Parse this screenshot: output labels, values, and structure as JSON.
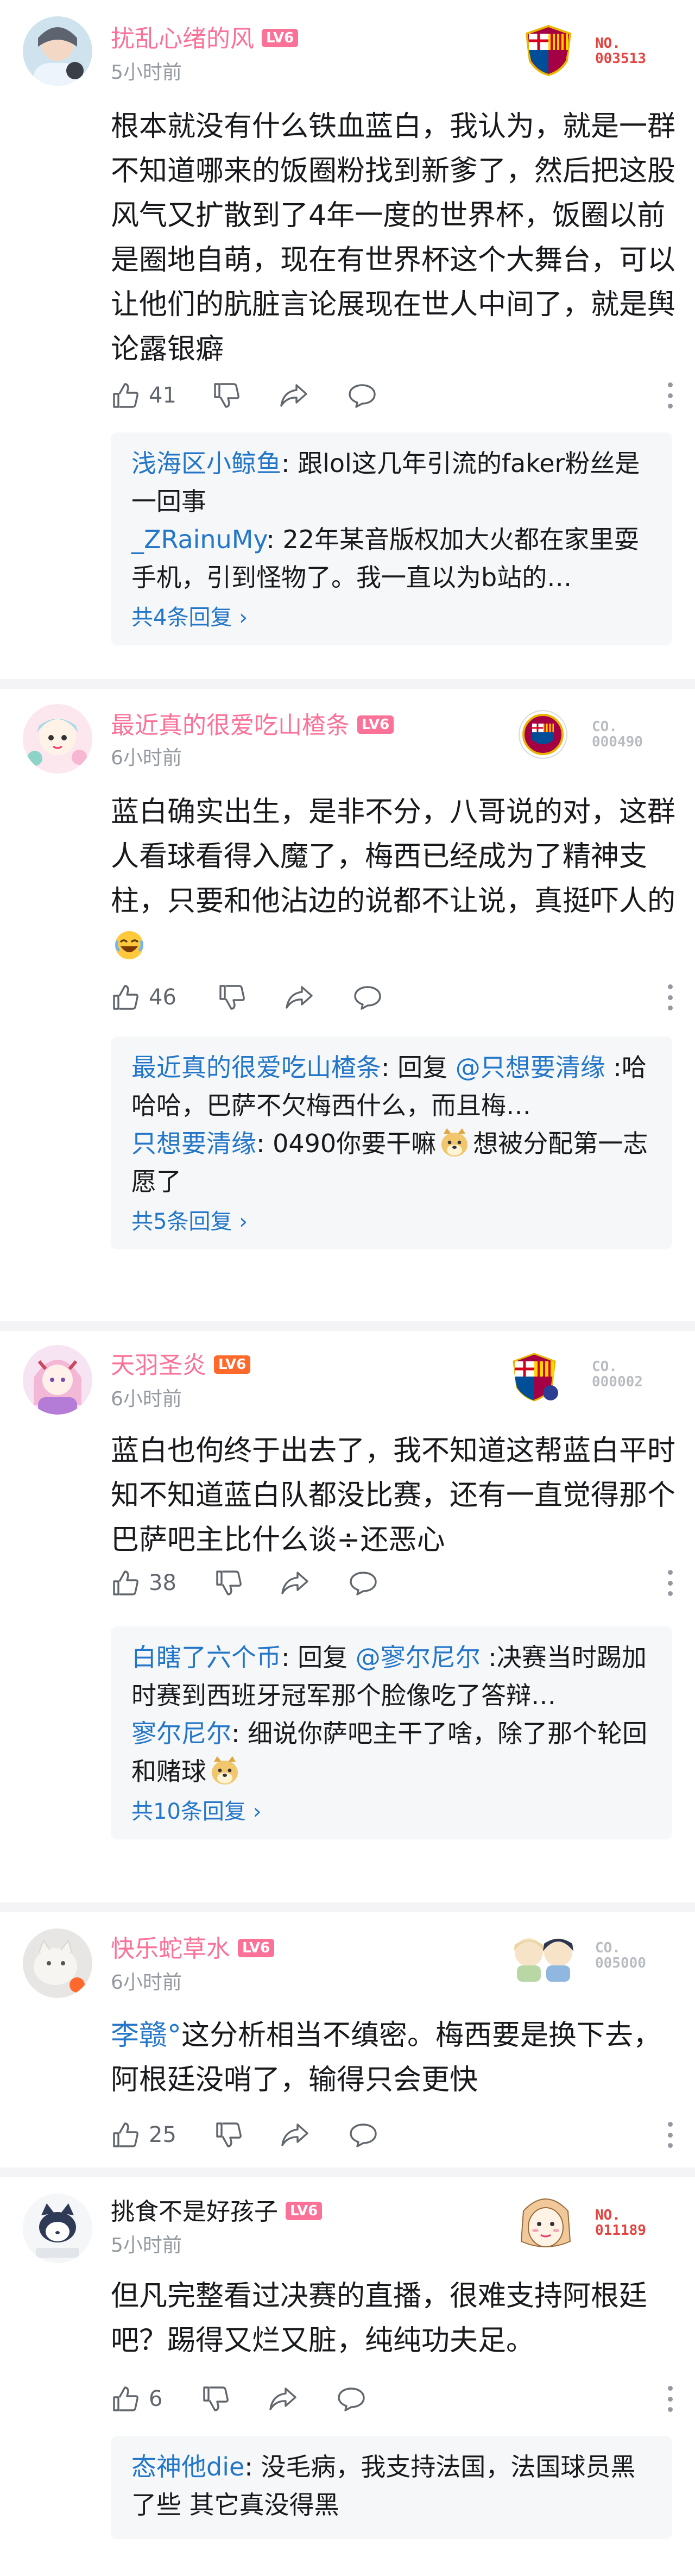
{
  "comments": [
    {
      "username": "扰乱心绪的风",
      "level": "LV6",
      "time": "5小时前",
      "fan_badge": "NO.\n003513",
      "content": "根本就没有什么铁血蓝白，我认为，就是一群不知道哪来的饭圈粉找到新爹了，然后把这股风气又扩散到了4年一度的世界杯，饭圈以前是圈地自萌，现在有世界杯这个大舞台，可以让他们的肮脏言论展现在世人中间了，就是舆论露银癖",
      "likes": "41",
      "replies": [
        {
          "name": "浅海区小鲸鱼",
          "sep": ": ",
          "text": "跟lol这几年引流的faker粉丝是一回事"
        },
        {
          "name": "_ZRainuMy",
          "sep": ": ",
          "text": "22年某音版权加大火都在家里耍手机，引到怪物了。我一直以为b站的…"
        }
      ],
      "more_replies": "共4条回复 ›"
    },
    {
      "username": "最近真的很爱吃山楂条",
      "level": "LV6",
      "time": "6小时前",
      "fan_badge": "CO.\n000490",
      "content": "蓝白确实出生，是非不分，八哥说的对，这群人看球看得入魔了，梅西已经成为了精神支柱，只要和他沾边的说都不让说，真挺吓人的",
      "likes": "46",
      "replies": [
        {
          "name": "最近真的很爱吃山楂条",
          "sep": ": ",
          "text": "回复 ",
          "mention": "@只想要清缘",
          "text2": " :哈哈哈，巴萨不欠梅西什么，而且梅…"
        },
        {
          "name": "只想要清缘",
          "sep": ": ",
          "text": "0490你要干嘛",
          "text2": "想被分配第一志愿了"
        }
      ],
      "more_replies": "共5条回复 ›"
    },
    {
      "username": "天羽圣炎",
      "level": "LV6",
      "time": "6小时前",
      "fan_badge": "CO.\n000002",
      "content": "蓝白也佝终于出去了，我不知道这帮蓝白平时知不知道蓝白队都没比赛，还有一直觉得那个巴萨吧主比什么谈÷还恶心",
      "likes": "38",
      "replies": [
        {
          "name": "白瞎了六个币",
          "sep": ": ",
          "text": "回复 ",
          "mention": "@寥尔尼尔",
          "text2": " :决赛当时踢加时赛到西班牙冠军那个脸像吃了答辩…"
        },
        {
          "name": "寥尔尼尔",
          "sep": ": ",
          "text": "细说你萨吧主干了啥，除了那个轮回和赌球"
        }
      ],
      "more_replies": "共10条回复 ›"
    },
    {
      "username": "快乐蛇草水",
      "level": "LV6",
      "time": "6小时前",
      "fan_badge": "CO.\n005000",
      "mention": "李赣°",
      "content": "这分析相当不缜密。梅西要是换下去，阿根廷没哨了，输得只会更快",
      "likes": "25"
    },
    {
      "username": "挑食不是好孩子",
      "level": "LV6",
      "time": "5小时前",
      "fan_badge": "NO.\n011189",
      "content": "但凡完整看过决赛的直播，很难支持阿根廷吧？踢得又烂又脏，纯纯功夫足。",
      "likes": "6",
      "replies": [
        {
          "name": "态神他die",
          "sep": ": ",
          "text": "没毛病，我支持法国，法国球员黑了些 其它真没得黑"
        }
      ]
    }
  ],
  "colors": {
    "accent_pink": "#fb7299",
    "link_blue": "#2376c8",
    "level_pink": "#fb7299",
    "level_orange": "#ff6a2c",
    "meta_grey": "#9499a0",
    "badge_red": "#e5433f"
  },
  "icons": [
    "like-icon",
    "dislike-icon",
    "share-icon",
    "comment-icon",
    "more-icon",
    "laugh-emoji",
    "doge-emoji"
  ]
}
